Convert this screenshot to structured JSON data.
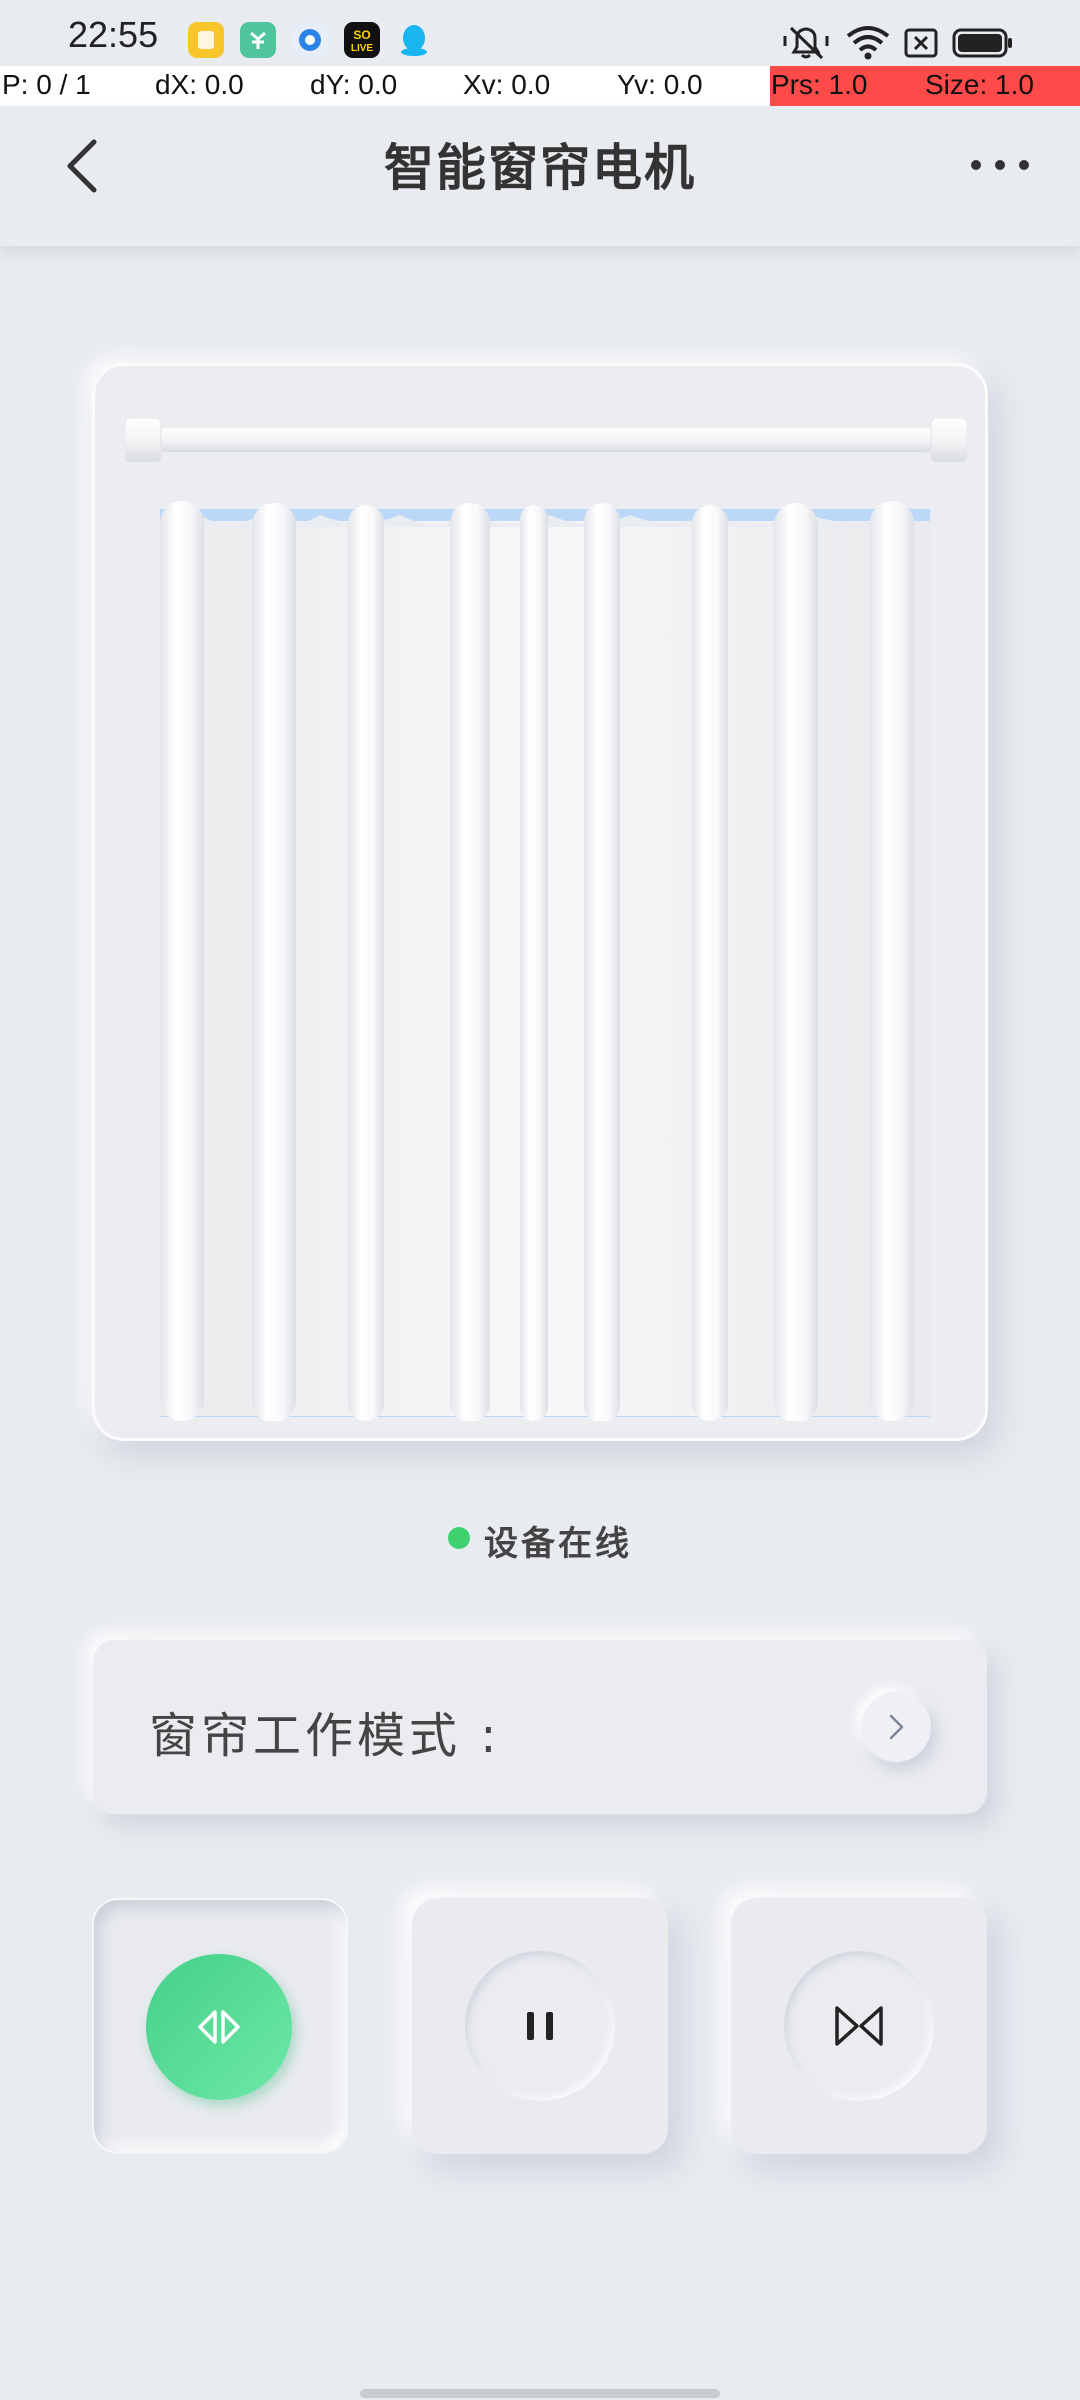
{
  "status_bar": {
    "time": "22:55",
    "app_icons": [
      "notes-app-icon",
      "market-app-icon",
      "browser-app-icon",
      "solive-app-icon",
      "qq-app-icon"
    ],
    "app_icon_colors": [
      "#f8c62a",
      "#4fc59b",
      "#2a84e8",
      "#111111",
      "#19b6f2"
    ],
    "solive_label": "SO LIVE",
    "right_icons": [
      "mute-icon",
      "wifi-icon",
      "sim-blocked-icon",
      "battery-icon"
    ]
  },
  "debug": {
    "pointer": "P: 0 / 1",
    "dx": "dX: 0.0",
    "dy": "dY: 0.0",
    "xv": "Xv: 0.0",
    "yv": "Yv: 0.0",
    "prs": "Prs: 1.0",
    "size": "Size: 1.0",
    "highlight_color": "#ff4a4a"
  },
  "header": {
    "title": "智能窗帘电机",
    "back_icon": "chevron-left-icon",
    "more_icon": "more-horizontal-icon"
  },
  "device": {
    "status_text": "设备在线",
    "status_color": "#3ed170"
  },
  "mode": {
    "label": "窗帘工作模式 :",
    "arrow_icon": "chevron-right-icon"
  },
  "controls": [
    {
      "name": "open",
      "icon": "open-curtain-icon",
      "active": true,
      "color": "#44d089"
    },
    {
      "name": "pause",
      "icon": "pause-icon",
      "active": false
    },
    {
      "name": "close",
      "icon": "close-curtain-icon",
      "active": false
    }
  ]
}
